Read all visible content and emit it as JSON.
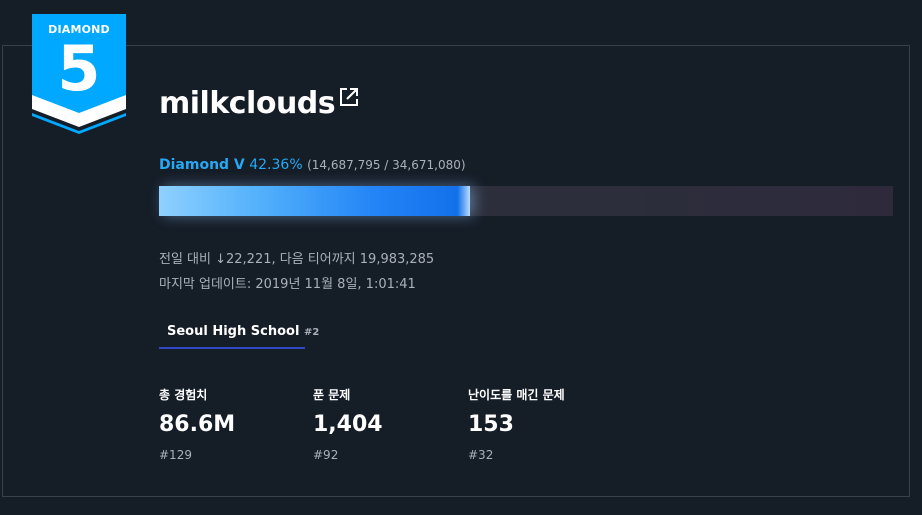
{
  "badge": {
    "label": "DIAMOND",
    "number": "5",
    "color": "#00a8ff"
  },
  "user": {
    "name": "milkclouds",
    "link_icon": "external-link-icon"
  },
  "tier": {
    "name": "Diamond V",
    "percent_text": "42.36%",
    "detail": "(14,687,795 / 34,671,080)",
    "progress": 0.4236
  },
  "info": {
    "daily": "전일 대비 ↓22,221, 다음 티어까지 19,983,285",
    "updated": "마지막 업데이트: 2019년 11월 8일, 1:01:41"
  },
  "school": {
    "name": "Seoul High School",
    "rank": "#2"
  },
  "stats": [
    {
      "label": "총 경험치",
      "value": "86.6M",
      "rank": "#129"
    },
    {
      "label": "푼 문제",
      "value": "1,404",
      "rank": "#92"
    },
    {
      "label": "난이도를 매긴 문제",
      "value": "153",
      "rank": "#32"
    }
  ]
}
